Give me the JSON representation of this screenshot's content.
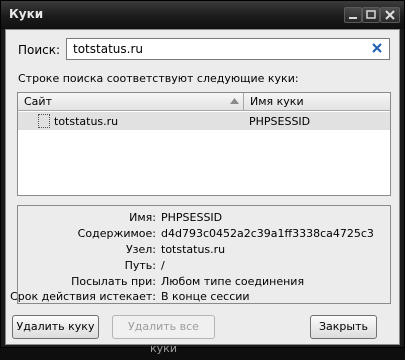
{
  "window": {
    "title": "Куки"
  },
  "search": {
    "label": "Поиск:",
    "value": "totstatus.ru"
  },
  "list": {
    "caption": "Строке поиска соответствуют следующие куки:",
    "columns": [
      "Сайт",
      "Имя куки"
    ],
    "rows": [
      {
        "site": "totstatus.ru",
        "name": "PHPSESSID"
      }
    ]
  },
  "details": {
    "fields": [
      {
        "label": "Имя:",
        "value": "PHPSESSID"
      },
      {
        "label": "Содержимое:",
        "value": "d4d793c0452a2c39a1ff3338ca4725c3"
      },
      {
        "label": "Узел:",
        "value": "totstatus.ru"
      },
      {
        "label": "Путь:",
        "value": "/"
      },
      {
        "label": "Посылать при:",
        "value": "Любом типе соединения"
      },
      {
        "label": "Срок действия истекает:",
        "value": "В конце сессии"
      }
    ]
  },
  "buttons": {
    "delete": "Удалить куку",
    "delete_all": "Удалить все куки",
    "close": "Закрыть"
  },
  "colors": {
    "accent_clear": "#1f5fb0"
  }
}
